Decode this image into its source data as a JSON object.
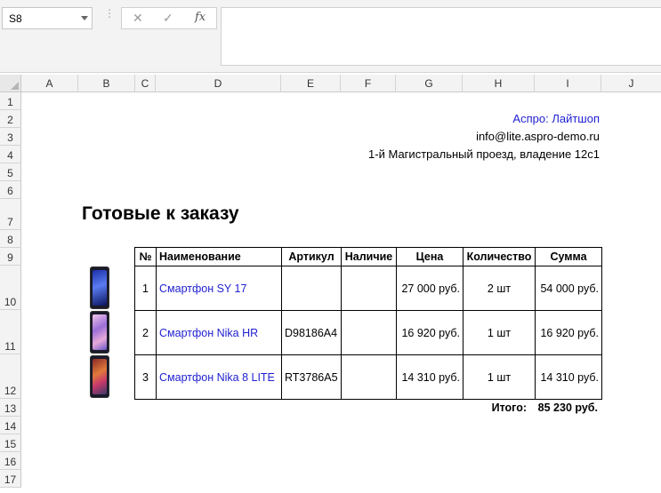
{
  "formula_bar": {
    "name_box": "S8",
    "cancel_icon": "✕",
    "enter_icon": "✓",
    "fx_label": "fx",
    "formula": ""
  },
  "columns": [
    "A",
    "B",
    "C",
    "D",
    "E",
    "F",
    "G",
    "H",
    "I",
    "J"
  ],
  "rows": [
    "1",
    "2",
    "3",
    "4",
    "5",
    "6",
    "7",
    "8",
    "9",
    "10",
    "11",
    "12",
    "13",
    "14",
    "15",
    "16",
    "17"
  ],
  "company": {
    "name": "Аспро: Лайтшоп",
    "email": "info@lite.aspro-demo.ru",
    "address": "1-й Магистральный проезд, владение 12с1"
  },
  "heading": "Готовые к заказу",
  "table": {
    "headers": [
      "№",
      "Наименование",
      "Артикул",
      "Наличие",
      "Цена",
      "Количество",
      "Сумма"
    ],
    "rows": [
      {
        "num": "1",
        "name": "Смартфон SY 17",
        "sku": "",
        "availability": "",
        "price": "27 000 руб.",
        "qty": "2 шт",
        "sum": "54 000 руб.",
        "image": "smartphone-blue"
      },
      {
        "num": "2",
        "name": "Смартфон Nika HR",
        "sku": "D98186A4",
        "availability": "",
        "price": "16 920 руб.",
        "qty": "1 шт",
        "sum": "16 920 руб.",
        "image": "smartphone-pink"
      },
      {
        "num": "3",
        "name": "Смартфон Nika 8 LITE",
        "sku": "RT3786A5",
        "availability": "",
        "price": "14 310 руб.",
        "qty": "1 шт",
        "sum": "14 310 руб.",
        "image": "smartphone-red"
      }
    ]
  },
  "total": {
    "label": "Итого:",
    "value": "85 230 руб."
  },
  "colors": {
    "link": "#1f1fd1"
  }
}
